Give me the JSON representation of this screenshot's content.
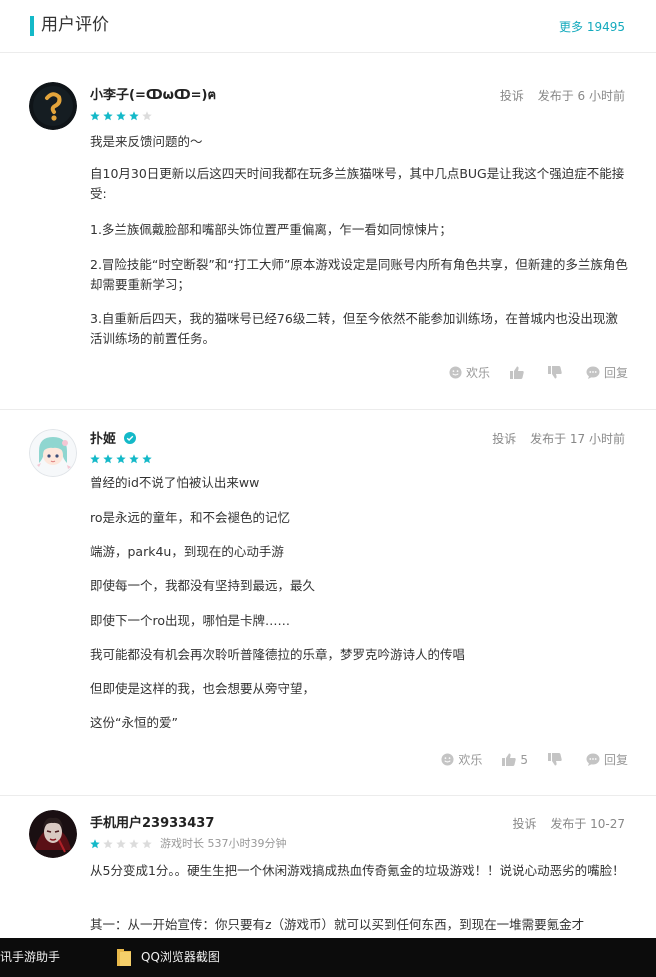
{
  "header": {
    "title": "用户评价",
    "more_label": "更多 19495"
  },
  "reviews": [
    {
      "username": "小李子(=ↀωↀ=)ฅ",
      "report": "投诉",
      "time": "发布于 6 小时前",
      "rating": 4,
      "paragraphs": [
        "我是来反馈问题的～",
        "自10月30日更新以后这四天时间我都在玩多兰族猫咪号，其中几点BUG是让我这个强迫症不能接受:",
        "1.多兰族佩戴脸部和嘴部头饰位置严重偏离，乍一看如同惊悚片；",
        "2.冒险技能“时空断裂”和“打工大师”原本游戏设定是同账号内所有角色共享，但新建的多兰族角色却需要重新学习；",
        "3.自重新后四天，我的猫咪号已经76级二转，但至今依然不能参加训练场，在普城内也没出现激活训练场的前置任务。"
      ],
      "actions": {
        "fun": "欢乐",
        "like": "",
        "dislike": "",
        "reply": "回复"
      }
    },
    {
      "username": "扑姬",
      "verified": true,
      "report": "投诉",
      "time": "发布于 17 小时前",
      "rating": 5,
      "paragraphs": [
        "曾经的id不说了怕被认出来ww",
        "ro是永远的童年，和不会褪色的记忆",
        "端游，park4u，到现在的心动手游",
        "即使每一个，我都没有坚持到最远，最久",
        "即使下一个ro出现，哪怕是卡牌……",
        "我可能都没有机会再次聆听普隆德拉的乐章，梦罗克吟游诗人的传唱",
        "但即使是这样的我，也会想要从旁守望，",
        "这份“永恒的爱”"
      ],
      "actions": {
        "fun": "欢乐",
        "like": "5",
        "dislike": "",
        "reply": "回复"
      }
    },
    {
      "username": "手机用户23933437",
      "report": "投诉",
      "time": "发布于 10-27",
      "rating": 1,
      "playtime": "游戏时长 537小时39分钟",
      "paragraphs": [
        "从5分变成1分。。硬生生把一个休闲游戏搞成热血传奇氪金的垃圾游戏！！说说心动恶劣的嘴脸！",
        "其一：从一开始宣传：你只要有z（游戏币）就可以买到任何东西，到现在一堆需要氪金才"
      ]
    }
  ],
  "taskbar": {
    "item1": "讯手游助手",
    "item2": "QQ浏览器截图"
  },
  "colors": {
    "accent": "#14b9c8",
    "star_on": "#14b9c8",
    "star_off": "#dcdcdc"
  }
}
